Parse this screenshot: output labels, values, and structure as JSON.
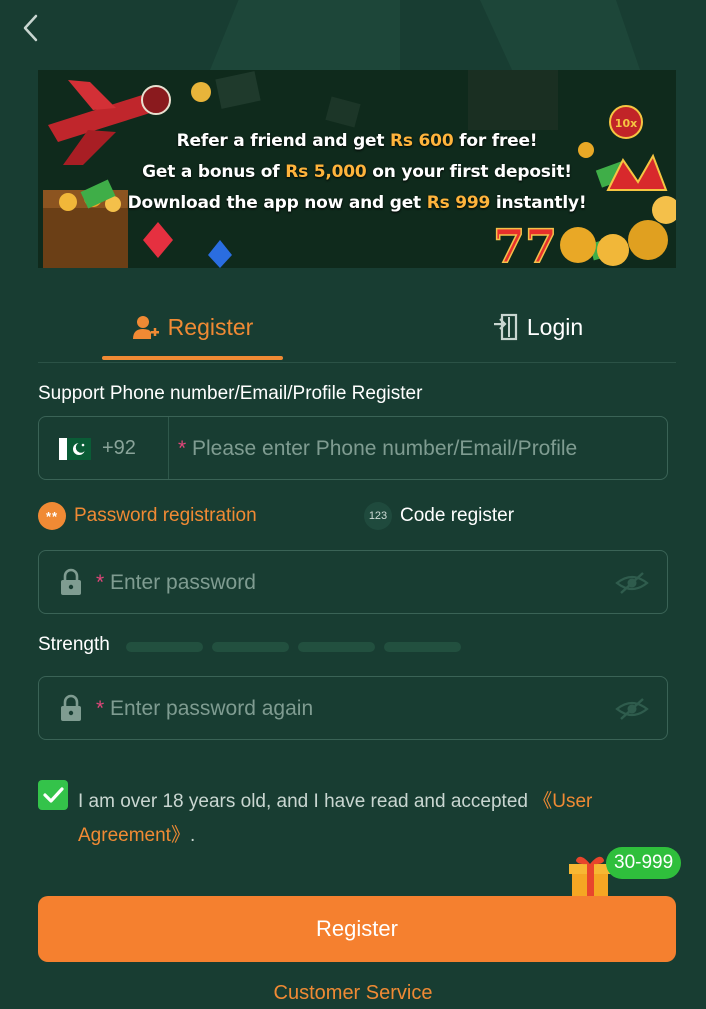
{
  "banner": {
    "line1_pre": "Refer a friend and get ",
    "line1_hl": "Rs 600",
    "line1_post": " for free!",
    "line2_pre": "Get a bonus of ",
    "line2_hl": "Rs 5,000",
    "line2_post": " on your first deposit!",
    "line3_pre": "Download the app now and get ",
    "line3_hl": "Rs 999",
    "line3_post": " instantly!",
    "badge": "10x"
  },
  "tabs": {
    "register": "Register",
    "login": "Login"
  },
  "form": {
    "support_label": "Support Phone number/Email/Profile Register",
    "dial_code": "+92",
    "required_mark": "*",
    "phone_placeholder": "Please enter Phone number/Email/Profile",
    "mode_password_icon": "**",
    "mode_password": "Password registration",
    "mode_code_icon": "123",
    "mode_code": "Code register",
    "password_placeholder": "Enter password",
    "strength_label": "Strength",
    "password_again_placeholder": "Enter password again",
    "agreement_text": "I am over 18 years old, and I have read and accepted ",
    "agreement_link": "《User Agreement》",
    "agreement_end": ".",
    "agreement_checked": true
  },
  "gift_badge": "30-999",
  "register_button": "Register",
  "customer_service": "Customer Service",
  "colors": {
    "background": "#183d32",
    "accent": "#f08a34",
    "button": "#f5802f",
    "check": "#34c34a"
  }
}
